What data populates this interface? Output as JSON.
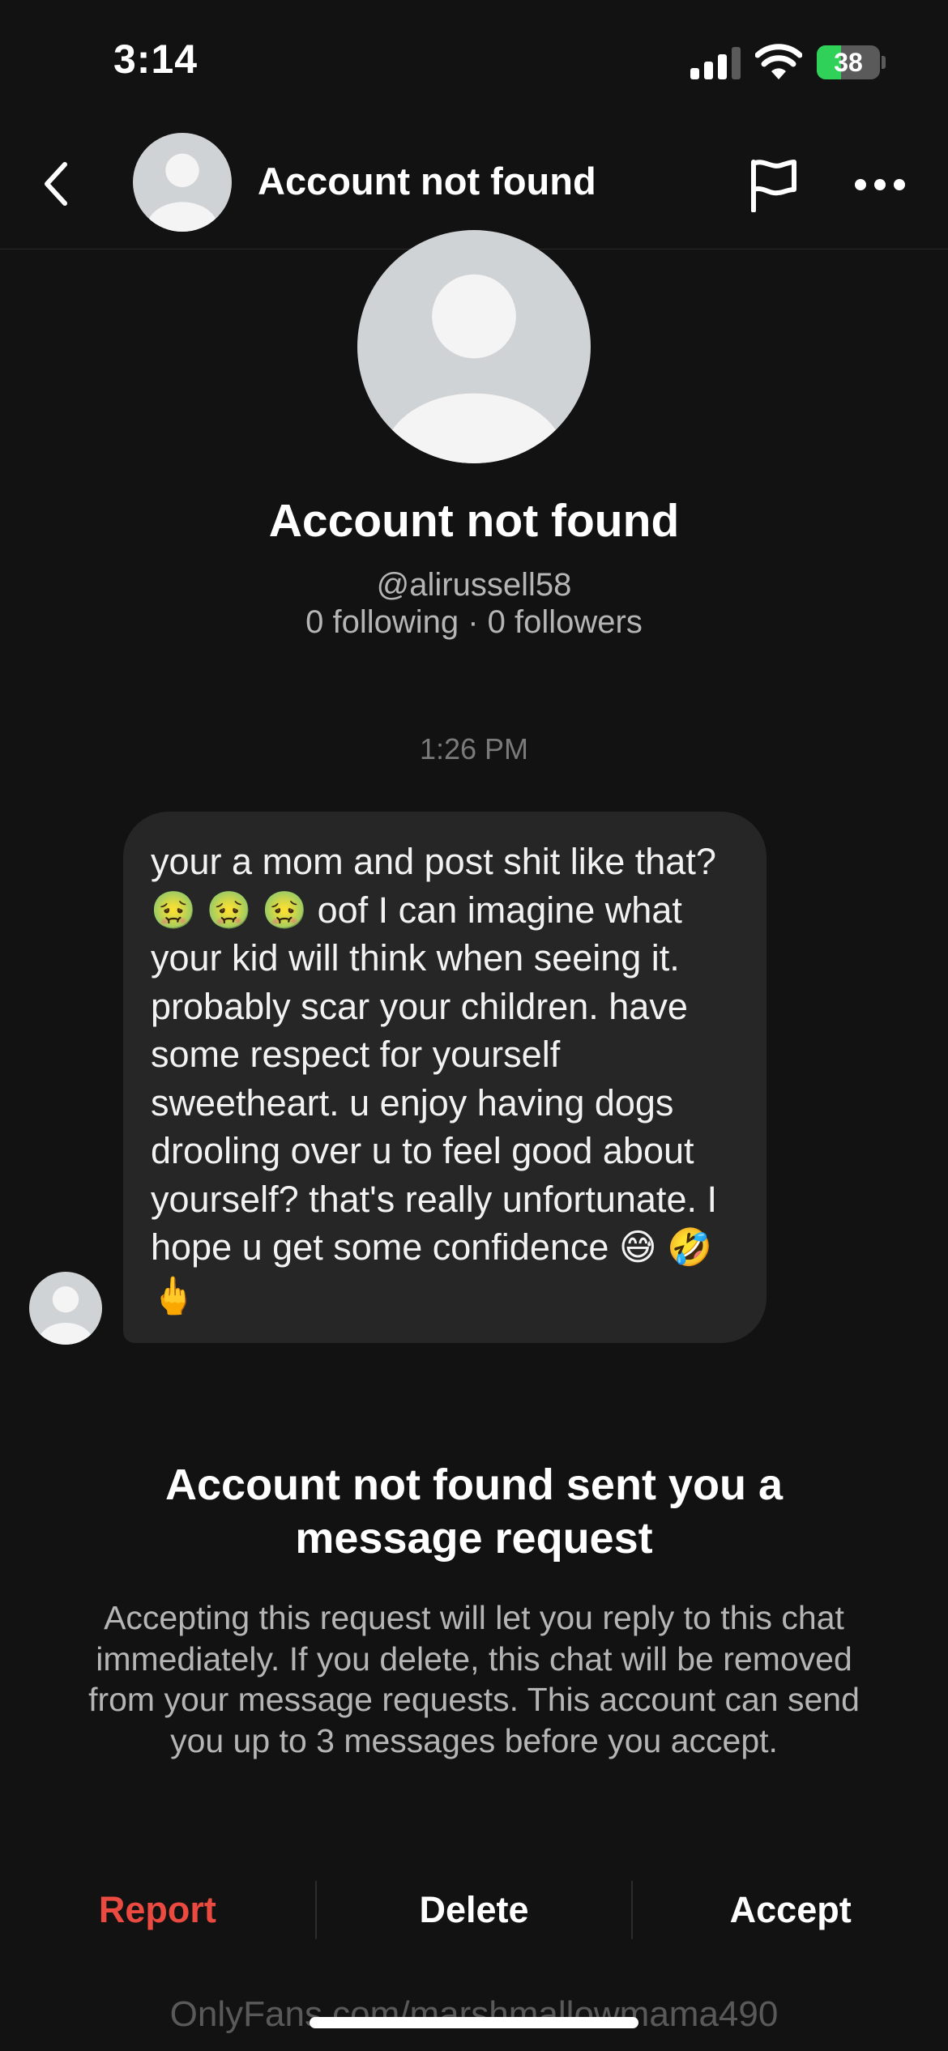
{
  "status_bar": {
    "time": "3:14",
    "battery_level": "38",
    "battery_charging": true,
    "icons": [
      "signal-icon",
      "wifi-icon",
      "battery-icon"
    ]
  },
  "header": {
    "title": "Account not found",
    "icons": [
      "chevron-left-icon",
      "avatar-icon",
      "flag-icon",
      "more-icon"
    ]
  },
  "profile": {
    "name": "Account not found",
    "handle": "@alirussell58",
    "stats": "0 following · 0 followers"
  },
  "conversation": {
    "timestamp": "1:26 PM",
    "message": "your a mom and post shit like that? 🤢 🤢 🤢 oof I can imagine what your kid will think when seeing it. probably scar your children. have some respect for yourself sweetheart. u enjoy having dogs drooling over u to feel good about yourself? that's really unfortunate. I hope u get some confidence 😅 🤣 🖕"
  },
  "request": {
    "title": "Account not found sent you a message request",
    "description": "Accepting this request will let you reply to this chat immediately. If you delete, this chat will be removed from your message requests. This account can send you up to 3 messages before you accept."
  },
  "actions": {
    "report": "Report",
    "delete": "Delete",
    "accept": "Accept"
  },
  "colors": {
    "background": "#121212",
    "bubble": "#262626",
    "report": "#ea4a3f",
    "battery": "#30d158",
    "avatar_bg": "#d0d3d5"
  },
  "watermark": "OnlyFans.com/marshmallowmama490"
}
